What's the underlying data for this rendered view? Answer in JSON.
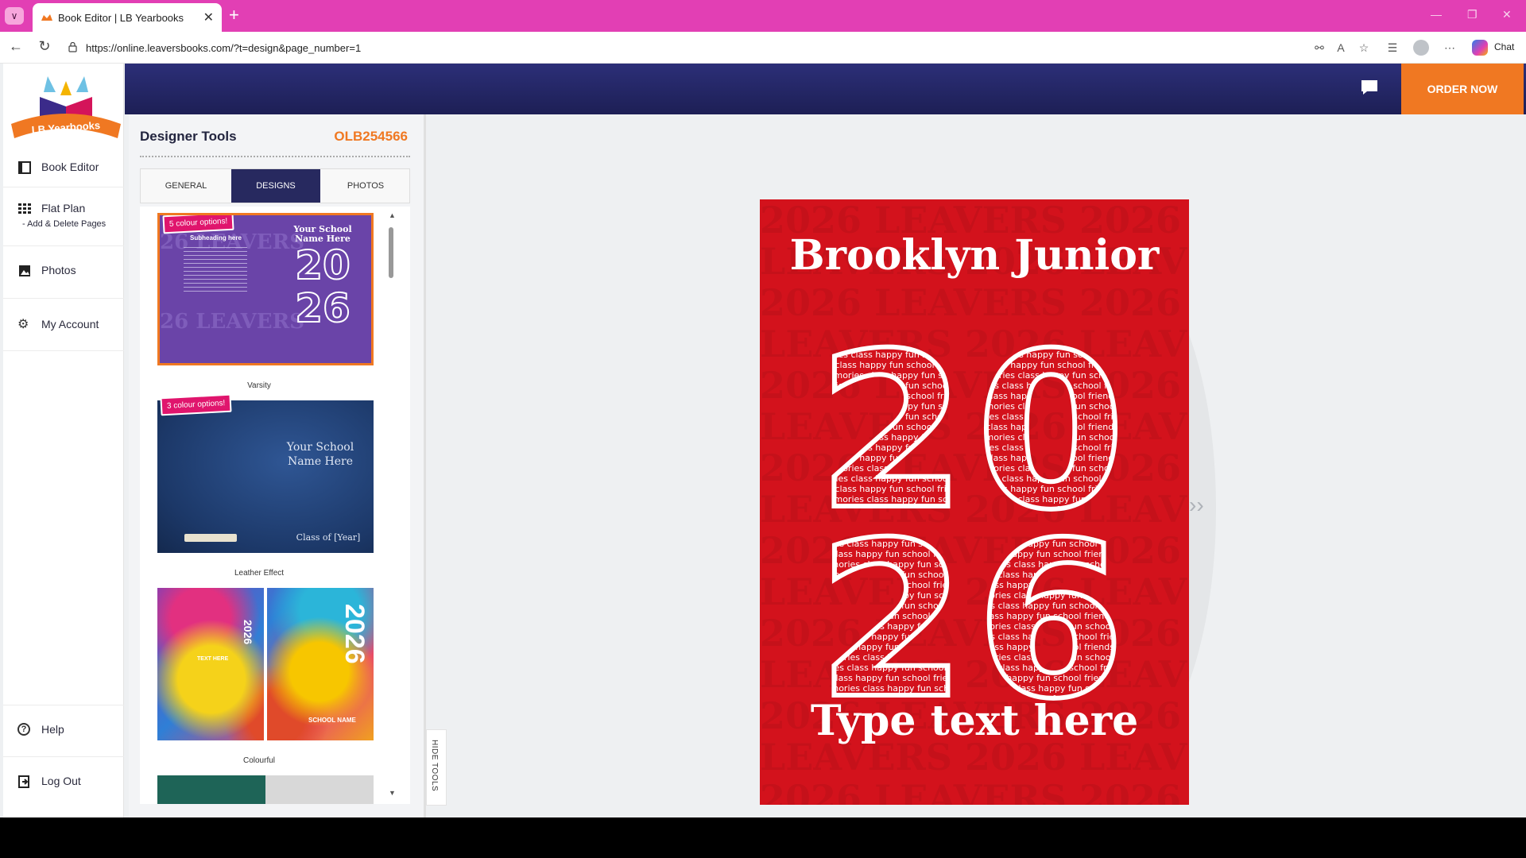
{
  "browser": {
    "tab_title": "Book Editor | LB Yearbooks",
    "url": "https://online.leaversbooks.com/?t=design&page_number=1",
    "chat_label": "Chat"
  },
  "sidebar": {
    "logo_text": "LB Yearbooks",
    "items": [
      {
        "label": "Book Editor",
        "icon": "book-icon"
      },
      {
        "label": "Flat Plan",
        "sub": "- Add & Delete Pages",
        "icon": "grid-icon"
      },
      {
        "label": "Photos",
        "icon": "photos-icon"
      },
      {
        "label": "My Account",
        "icon": "gear-icon"
      }
    ],
    "bottom": [
      {
        "label": "Help",
        "icon": "help-icon"
      },
      {
        "label": "Log Out",
        "icon": "logout-icon"
      }
    ]
  },
  "header": {
    "order_label": "ORDER NOW",
    "order_color": "#f07822",
    "bar_color": "#23265f"
  },
  "panel": {
    "title": "Designer Tools",
    "code": "OLB254566",
    "tabs": [
      "GENERAL",
      "DESIGNS",
      "PHOTOS"
    ],
    "active_tab": "DESIGNS",
    "designs": [
      {
        "name": "Varsity",
        "badge": "5 colour options!",
        "subheading": "Subheading here",
        "school": "Your School Name Here",
        "year_top": "20",
        "year_bottom": "26",
        "pattern": "26 LEAVERS"
      },
      {
        "name": "Leather Effect",
        "badge": "3 colour options!",
        "school": "Your School Name Here",
        "class": "Class of [Year]"
      },
      {
        "name": "Colourful",
        "year": "2026",
        "text_here": "TEXT HERE",
        "school_name": "SCHOOL NAME"
      }
    ],
    "hide_tools": "HIDE TOOLS"
  },
  "cover": {
    "title": "Brooklyn Junior",
    "digits": [
      "2",
      "0",
      "2",
      "6"
    ],
    "footer": "Type text here",
    "word_fill": "memories class happy fun school friends teachers leavers lessons",
    "background_color": "#d3121c"
  }
}
